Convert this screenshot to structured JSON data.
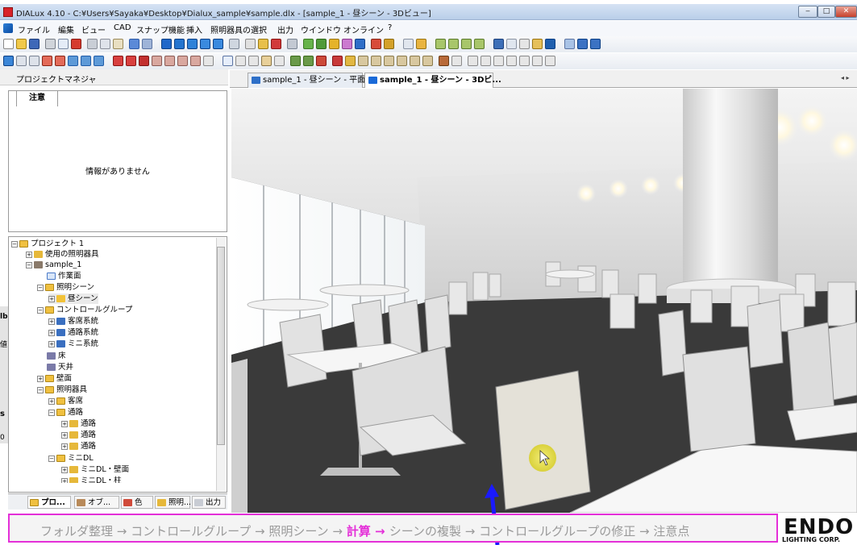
{
  "window": {
    "title": "DIALux 4.10 - C:¥Users¥Sayaka¥Desktop¥Dialux_sample¥sample.dlx - [sample_1 - 昼シーン - 3Dビュー]",
    "controls": [
      "‒",
      "□",
      "✕"
    ]
  },
  "menu": [
    "ファイル",
    "編集",
    "ビュー",
    "CAD",
    "スナップ機能",
    "挿入",
    "照明器具の選択",
    "出力",
    "ウインドウ",
    "オンライン",
    "?"
  ],
  "left_panel": {
    "header": "プロジェクトマネジャ",
    "notice_tab": "注意",
    "notice_message": "情報がありません"
  },
  "tree": [
    {
      "label": "プロジェクト 1",
      "indent": 0,
      "icon": "folder"
    },
    {
      "label": "使用の照明器具",
      "indent": 1,
      "icon": "luminaire"
    },
    {
      "label": "sample_1",
      "indent": 1,
      "icon": "room"
    },
    {
      "label": "作業面",
      "indent": 2,
      "icon": "workplane"
    },
    {
      "label": "照明シーン",
      "indent": 2,
      "icon": "folder"
    },
    {
      "label": "昼シーン",
      "indent": 3,
      "icon": "scene"
    },
    {
      "label": "コントロールグループ",
      "indent": 2,
      "icon": "folder"
    },
    {
      "label": "客席系統",
      "indent": 3,
      "icon": "group"
    },
    {
      "label": "通路系統",
      "indent": 3,
      "icon": "group"
    },
    {
      "label": "ミニ系統",
      "indent": 3,
      "icon": "group"
    },
    {
      "label": "床",
      "indent": 2,
      "icon": "surface"
    },
    {
      "label": "天井",
      "indent": 2,
      "icon": "surface"
    },
    {
      "label": "壁面",
      "indent": 2,
      "icon": "folder"
    },
    {
      "label": "照明器具",
      "indent": 2,
      "icon": "folder"
    },
    {
      "label": "客席",
      "indent": 3,
      "icon": "folder"
    },
    {
      "label": "通路",
      "indent": 3,
      "icon": "folder"
    },
    {
      "label": "通路",
      "indent": 4,
      "icon": "luminaire"
    },
    {
      "label": "通路",
      "indent": 4,
      "icon": "luminaire"
    },
    {
      "label": "通路",
      "indent": 4,
      "icon": "luminaire"
    },
    {
      "label": "ミニDL",
      "indent": 3,
      "icon": "folder"
    },
    {
      "label": "ミニDL・壁面",
      "indent": 4,
      "icon": "luminaire"
    },
    {
      "label": "ミニDL・柱",
      "indent": 4,
      "icon": "luminaire"
    }
  ],
  "bottom_tabs": [
    "プロ...",
    "オブ...",
    "色",
    "照明...",
    "出力"
  ],
  "doc_tabs": [
    "sample_1 - 昼シーン - 平面図",
    "sample_1 - 昼シーン - 3Dビ..."
  ],
  "doc_tab_scroll": "◂ ▸",
  "caption": {
    "parts": [
      "フォルダ整理",
      "コントロールグループ",
      "照明シーン",
      "計算",
      "シーンの複製",
      "コントロールグループの修正",
      "注意点"
    ],
    "arrow": " → ",
    "highlight_index": 3
  },
  "logo": {
    "brand": "ENDO",
    "sub": "LIGHTING CORP."
  },
  "edge_letters": [
    "lb",
    "値",
    "",
    "",
    "s",
    "0"
  ],
  "colors": {
    "accent": "#e42fd8",
    "annotation_arrow": "#1a1aff"
  }
}
